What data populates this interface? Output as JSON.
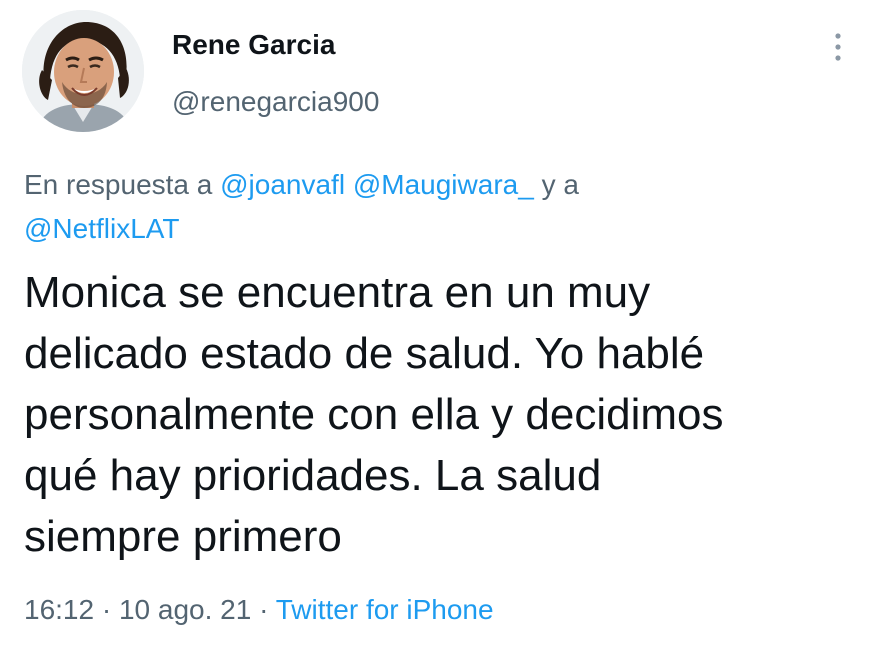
{
  "author": {
    "display_name": "Rene Garcia",
    "handle": "@renegarcia900"
  },
  "reply": {
    "prefix": "En respuesta a",
    "mention_1": "@joanvafl",
    "mention_2": "@Maugiwara_",
    "conjunction": "y a",
    "mention_3": "@NetflixLAT"
  },
  "tweet": {
    "lines": [
      "Monica se encuentra en un muy",
      "delicado estado de salud. Yo hablé",
      "personalmente con ella y decidimos",
      "qué hay prioridades. La salud",
      "siempre primero"
    ]
  },
  "meta": {
    "time": "16:12",
    "sep1": "·",
    "date": "10 ago. 21",
    "sep2": "·",
    "source": "Twitter for iPhone"
  },
  "icons": {
    "more": "more-vertical-icon"
  },
  "colors": {
    "link": "#1d9bf0",
    "secondary_text": "#536471",
    "primary_text": "#0f1419"
  }
}
